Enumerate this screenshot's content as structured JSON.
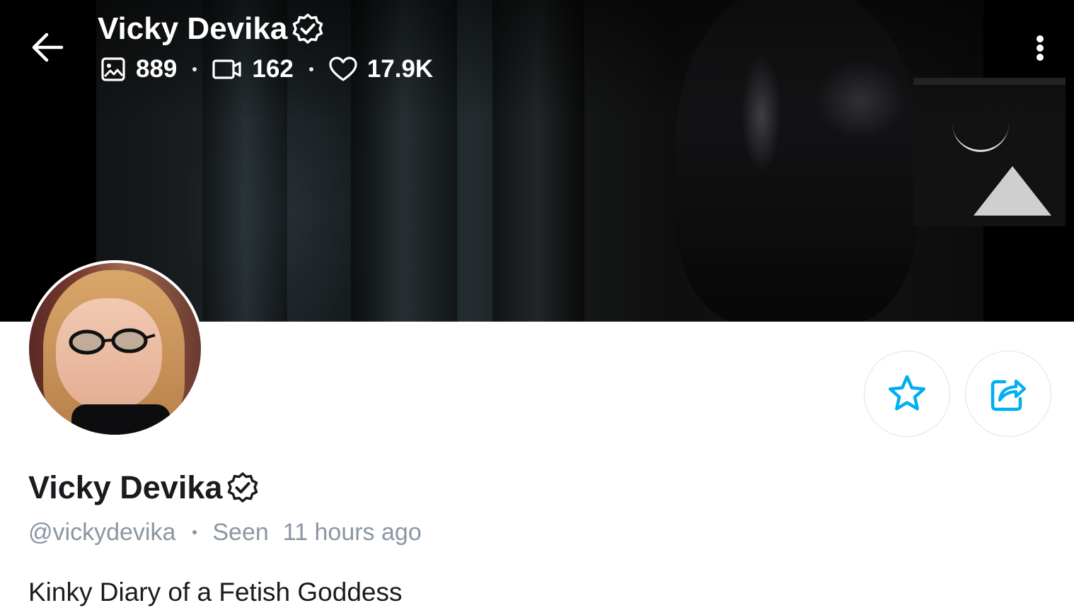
{
  "header": {
    "name": "Vicky Devika",
    "stats": {
      "photos": "889",
      "videos": "162",
      "likes": "17.9K"
    }
  },
  "profile": {
    "name": "Vicky Devika",
    "username": "@vickydevika",
    "seen_label": "Seen",
    "seen_time": "11 hours ago",
    "bio": "Kinky Diary of a Fetish Goddess"
  },
  "icons": {
    "back": "arrow-left-icon",
    "more": "more-vertical-icon",
    "photos": "image-icon",
    "videos": "video-icon",
    "likes": "heart-icon",
    "verified": "verified-badge-icon",
    "favorite": "star-icon",
    "share": "share-icon"
  },
  "colors": {
    "accent": "#00aff0",
    "text_primary": "#1b1b1f",
    "text_secondary": "#8a96a3",
    "button_border": "#dfe3e8"
  }
}
